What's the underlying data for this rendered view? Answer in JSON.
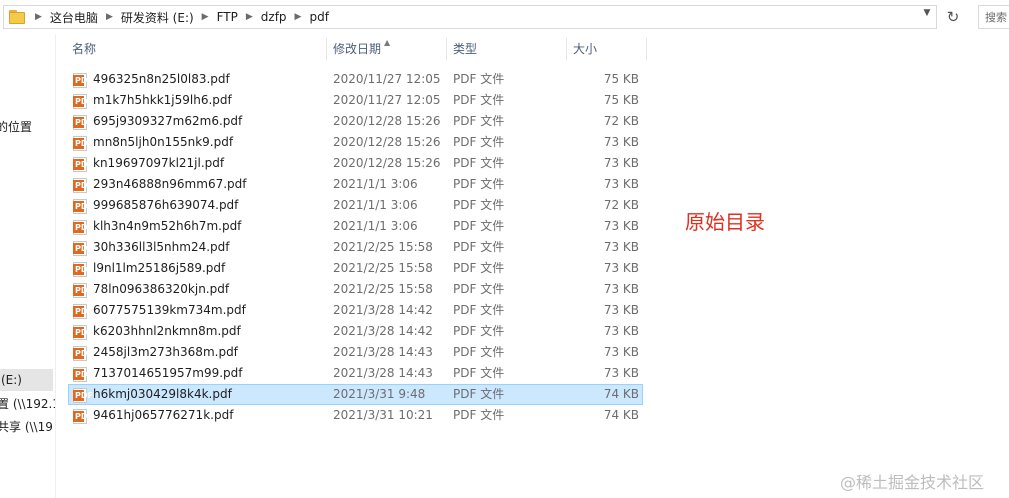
{
  "address_bar": {
    "crumbs": [
      "这台电脑",
      "研发资料 (E:)",
      "FTP",
      "dzfp",
      "pdf"
    ],
    "search_placeholder": "搜索"
  },
  "nav": {
    "items": [
      {
        "label": "的位置"
      },
      {
        "label": "(E:)"
      },
      {
        "label": "置 (\\\\192.1"
      },
      {
        "label": "共享 (\\\\19"
      }
    ]
  },
  "columns": {
    "name": "名称",
    "date": "修改日期",
    "type": "类型",
    "size": "大小"
  },
  "files": [
    {
      "name": "496325n8n25l0l83.pdf",
      "date": "2020/11/27 12:05",
      "type": "PDF 文件",
      "size": "75 KB"
    },
    {
      "name": "m1k7h5hkk1j59lh6.pdf",
      "date": "2020/11/27 12:05",
      "type": "PDF 文件",
      "size": "75 KB"
    },
    {
      "name": "695j9309327m62m6.pdf",
      "date": "2020/12/28 15:26",
      "type": "PDF 文件",
      "size": "72 KB"
    },
    {
      "name": "mn8n5ljh0n155nk9.pdf",
      "date": "2020/12/28 15:26",
      "type": "PDF 文件",
      "size": "73 KB"
    },
    {
      "name": "kn19697097kl21jl.pdf",
      "date": "2020/12/28 15:26",
      "type": "PDF 文件",
      "size": "73 KB"
    },
    {
      "name": "293n46888n96mm67.pdf",
      "date": "2021/1/1 3:06",
      "type": "PDF 文件",
      "size": "73 KB"
    },
    {
      "name": "999685876h639074.pdf",
      "date": "2021/1/1 3:06",
      "type": "PDF 文件",
      "size": "72 KB"
    },
    {
      "name": "klh3n4n9m52h6h7m.pdf",
      "date": "2021/1/1 3:06",
      "type": "PDF 文件",
      "size": "73 KB"
    },
    {
      "name": "30h336ll3l5nhm24.pdf",
      "date": "2021/2/25 15:58",
      "type": "PDF 文件",
      "size": "73 KB"
    },
    {
      "name": "l9nl1lm25186j589.pdf",
      "date": "2021/2/25 15:58",
      "type": "PDF 文件",
      "size": "73 KB"
    },
    {
      "name": "78ln096386320kjn.pdf",
      "date": "2021/2/25 15:58",
      "type": "PDF 文件",
      "size": "73 KB"
    },
    {
      "name": "6077575139km734m.pdf",
      "date": "2021/3/28 14:42",
      "type": "PDF 文件",
      "size": "73 KB"
    },
    {
      "name": "k6203hhnl2nkmn8m.pdf",
      "date": "2021/3/28 14:42",
      "type": "PDF 文件",
      "size": "73 KB"
    },
    {
      "name": "2458jl3m273h368m.pdf",
      "date": "2021/3/28 14:43",
      "type": "PDF 文件",
      "size": "73 KB"
    },
    {
      "name": "7137014651957m99.pdf",
      "date": "2021/3/28 14:43",
      "type": "PDF 文件",
      "size": "73 KB"
    },
    {
      "name": "h6kmj030429l8k4k.pdf",
      "date": "2021/3/31 9:48",
      "type": "PDF 文件",
      "size": "74 KB",
      "selected": true
    },
    {
      "name": "9461hj065776271k.pdf",
      "date": "2021/3/31 10:21",
      "type": "PDF 文件",
      "size": "74 KB"
    }
  ],
  "icons": {
    "file": "pdf-file-icon",
    "pdf_badge": "PDF",
    "folder": "folder-icon",
    "refresh": "refresh-icon",
    "dropdown": "chevron-down-icon"
  },
  "annotation": "原始目录",
  "watermark": "@稀土掘金技术社区",
  "colors": {
    "selection_bg": "#cce8ff",
    "selection_border": "#99d1ff",
    "header_text": "#4c607a",
    "annotation": "#e02f1f"
  }
}
